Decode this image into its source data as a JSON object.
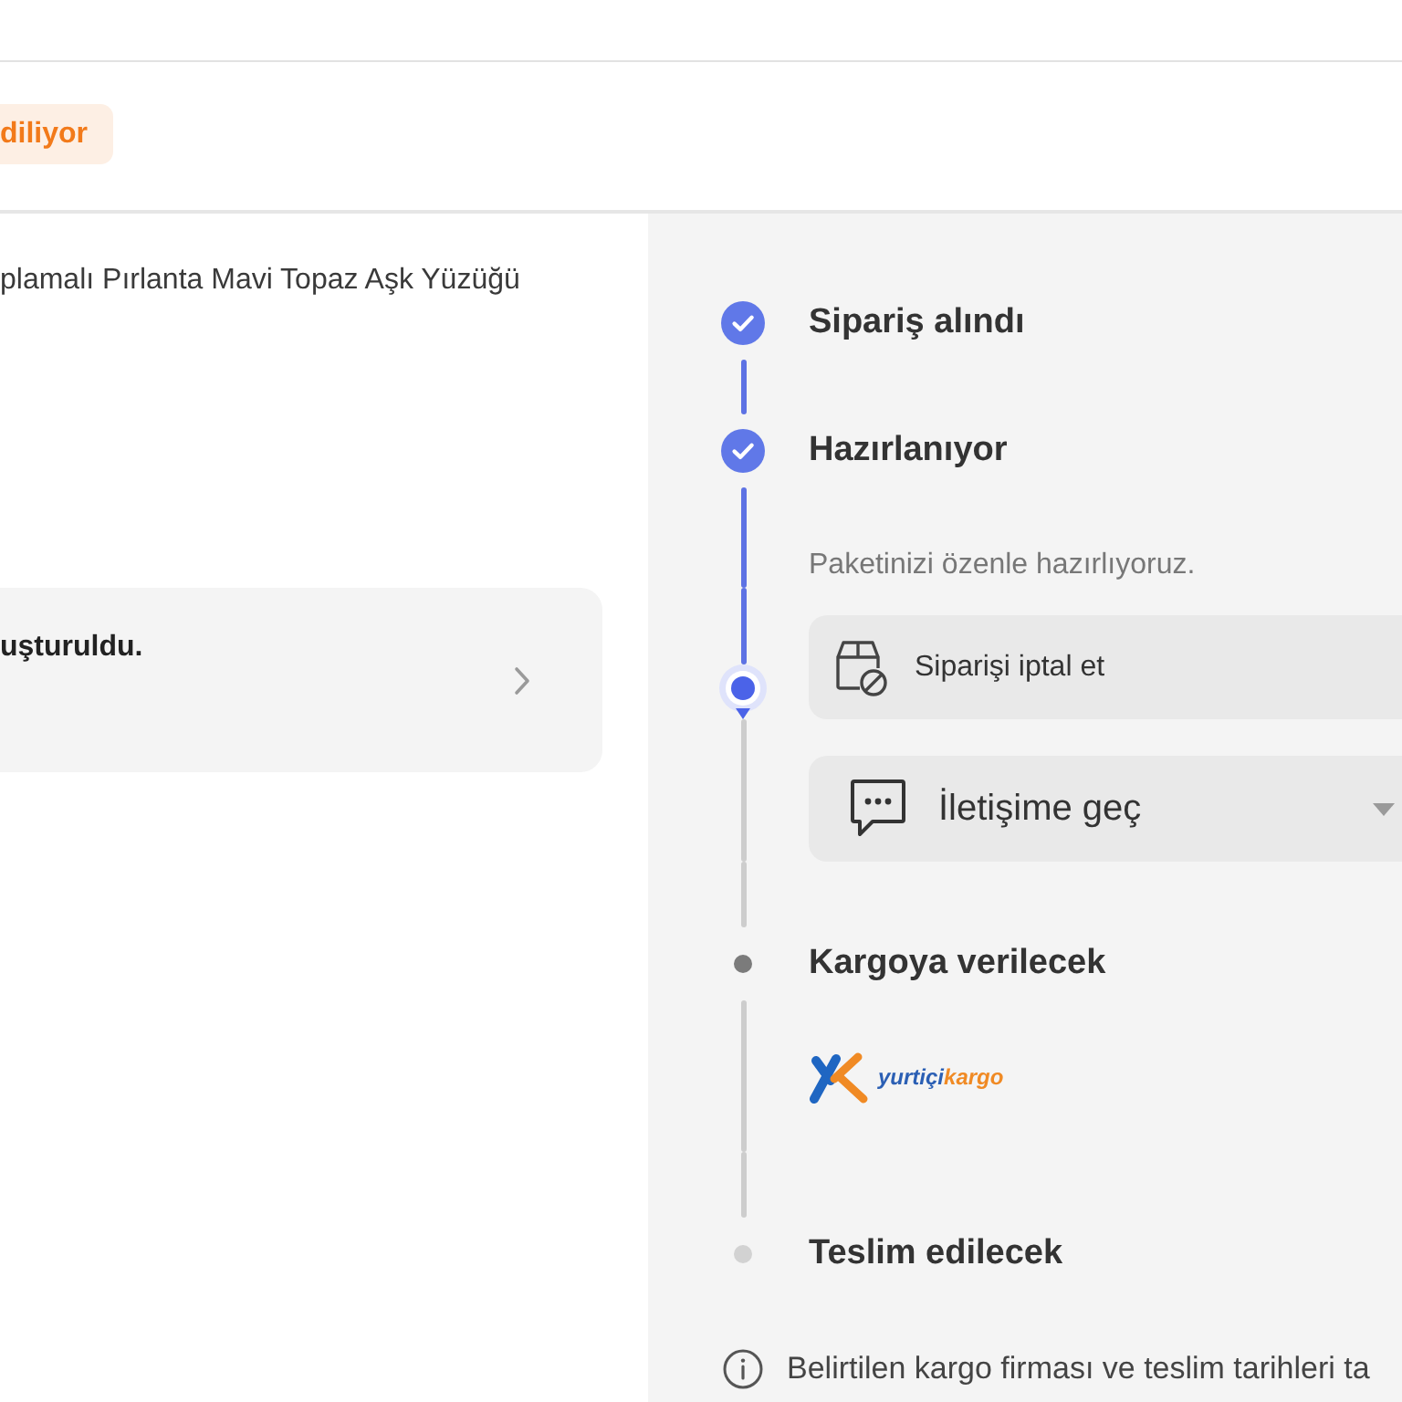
{
  "status_badge": {
    "text": "diliyor"
  },
  "product": {
    "name": "plamalı Pırlanta Mavi Topaz Aşk Yüzüğü"
  },
  "notice_card": {
    "text": "uşturuldu."
  },
  "timeline": {
    "steps": [
      {
        "label": "Sipariş alındı",
        "completed": true
      },
      {
        "label": "Hazırlanıyor",
        "completed": true,
        "description": "Paketinizi özenle hazırlıyoruz.",
        "progress_marker": true,
        "actions": [
          {
            "kind": "cancel",
            "label": "Siparişi iptal et",
            "expandable": false
          },
          {
            "kind": "contact",
            "label": "İletişime geç",
            "expandable": true
          }
        ]
      },
      {
        "label": "Kargoya verilecek",
        "completed": false,
        "upcoming": true,
        "carrier_logo": {
          "wordmark": [
            "yurtiçi",
            "kargo"
          ]
        }
      },
      {
        "label": "Teslim edilecek",
        "completed": false,
        "upcoming": false
      }
    ]
  },
  "info_note": {
    "text": "Belirtilen kargo firması ve teslim tarihleri ta"
  }
}
